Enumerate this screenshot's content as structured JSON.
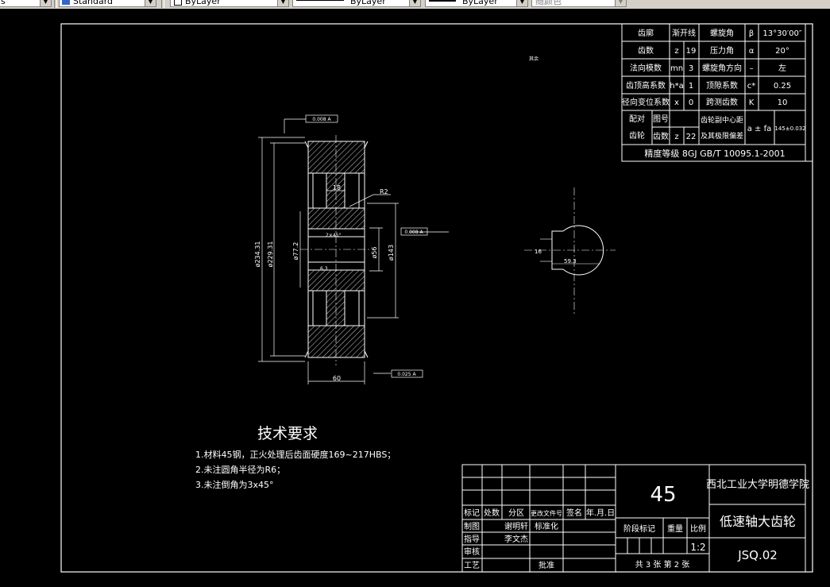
{
  "toolbar": {
    "combo_partial": "s",
    "text_style": "Standard",
    "layer_combo": "ByLayer",
    "linetype_combo": "ByLayer",
    "lineweight_combo": "ByLayer",
    "plot_style": "随颜色"
  },
  "param_table": {
    "rows": [
      [
        "齿廓",
        "渐开线",
        "螺旋角",
        "β",
        "13°30′00″"
      ],
      [
        "齿数",
        "z",
        "19",
        "压力角",
        "α",
        "20°"
      ],
      [
        "法向模数",
        "mn",
        "3",
        "螺旋角方向",
        "–",
        "左"
      ],
      [
        "齿顶高系数",
        "h*a",
        "1",
        "顶隙系数",
        "c*",
        "0.25"
      ],
      [
        "径向变位系数",
        "x",
        "0",
        "跨测齿数",
        "K",
        "10"
      ]
    ],
    "r1": {
      "a": "齿廓",
      "b": "渐开线",
      "c": "螺旋角",
      "d": "β",
      "e": "13°30′00″"
    },
    "r2": {
      "a": "齿数",
      "b": "z",
      "c": "19",
      "d": "压力角",
      "e": "α",
      "f": "20°"
    },
    "r3": {
      "a": "法向模数",
      "b": "mn",
      "c": "3",
      "d": "螺旋角方向",
      "e": "–",
      "f": "左"
    },
    "r4": {
      "a": "齿顶高系数",
      "b": "h*a",
      "c": "1",
      "d": "顶隙系数",
      "e": "c*",
      "f": "0.25"
    },
    "r5": {
      "a": "径向变位系数",
      "b": "x",
      "c": "0",
      "d": "跨测齿数",
      "e": "K",
      "f": "10"
    },
    "mate_a": "配对",
    "mate_b": "齿轮",
    "drawing_no": "图号",
    "teeth": "齿数",
    "z": "z",
    "z_val": "22",
    "center_tol": "齿轮副中心距",
    "center_tol2": "及其极限偏差",
    "a_fa": "a ± fa",
    "a_fa_val": "145±0.032",
    "accuracy": "精度等级  8GJ GB/T 10095.1-2001"
  },
  "drawing": {
    "dim_234": "ø234.31",
    "dim_229": "ø229.31",
    "dim_772": "ø77.2",
    "dim_56": "ø56",
    "dim_60": "60",
    "dim_18": "18",
    "dim_r2": "R2",
    "dim_143": "ø143",
    "dim_16": "16",
    "dim_60_bot": "60",
    "dim_chamfer": "2×45°",
    "tol_1": "0.008 A",
    "tol_2": "0.008 A",
    "tol_3": "0.025 A",
    "tol_4": "0.025 A",
    "rough_1": "3.2",
    "rough_2": "3.2",
    "rough_3": "6.3",
    "rough_other": "其余",
    "key_dim": "16",
    "key_dim2": "59.3"
  },
  "tech_req": {
    "title": "技术要求",
    "item1": "1.材料45钢，正火处理后齿面硬度169~217HBS；",
    "item2": "2.未注圆角半径为R6；",
    "item3": "3.未注倒角为3x45°"
  },
  "title_block": {
    "material": "45",
    "school": "西北工业大学明德学院",
    "part_name": "低速轴大齿轮",
    "drawing_code": "JSQ.02",
    "h_mark": "标记",
    "h_count": "处数",
    "h_zone": "分区",
    "h_docno": "更改文件号",
    "h_sign": "签名",
    "h_date": "年.月.日",
    "designer_label": "制图",
    "designer": "谢明轩",
    "std_label": "标准化",
    "guide_label": "指导",
    "guide": "李文杰",
    "review_label": "审核",
    "process_label": "工艺",
    "approve_label": "批准",
    "stage_label": "阶段标记",
    "weight_label": "重量",
    "scale_label": "比例",
    "scale": "1:2",
    "sheets": "共 3 张  第 2 张"
  }
}
